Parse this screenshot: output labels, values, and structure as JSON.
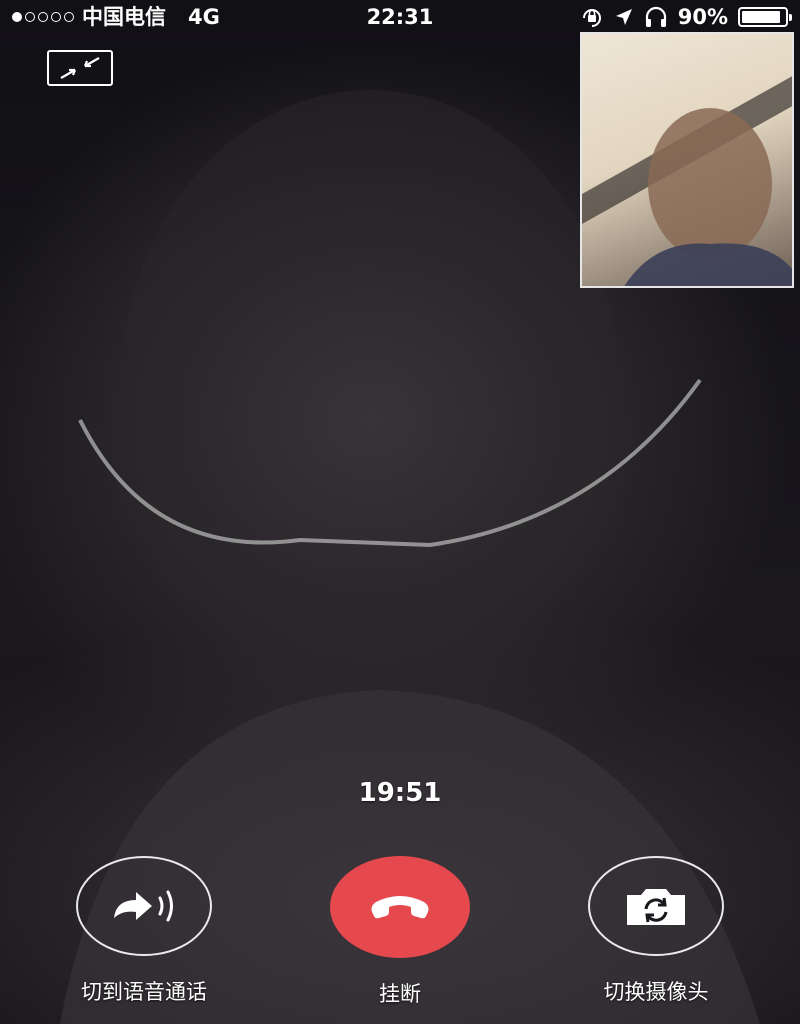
{
  "status_bar": {
    "signal_bars_filled": 1,
    "signal_bars_total": 5,
    "carrier": "中国电信",
    "network": "4G",
    "time": "22:31",
    "battery_text": "90%",
    "battery_level": 0.9,
    "icons": [
      "orientation-lock-icon",
      "location-arrow-icon",
      "headphones-icon",
      "battery-icon"
    ]
  },
  "call": {
    "timer": "19:51"
  },
  "controls": {
    "switch_to_voice_label": "切到语音通话",
    "hang_up_label": "挂断",
    "switch_camera_label": "切换摄像头"
  },
  "colors": {
    "hangup": "#e5484d",
    "text": "#ffffff"
  }
}
